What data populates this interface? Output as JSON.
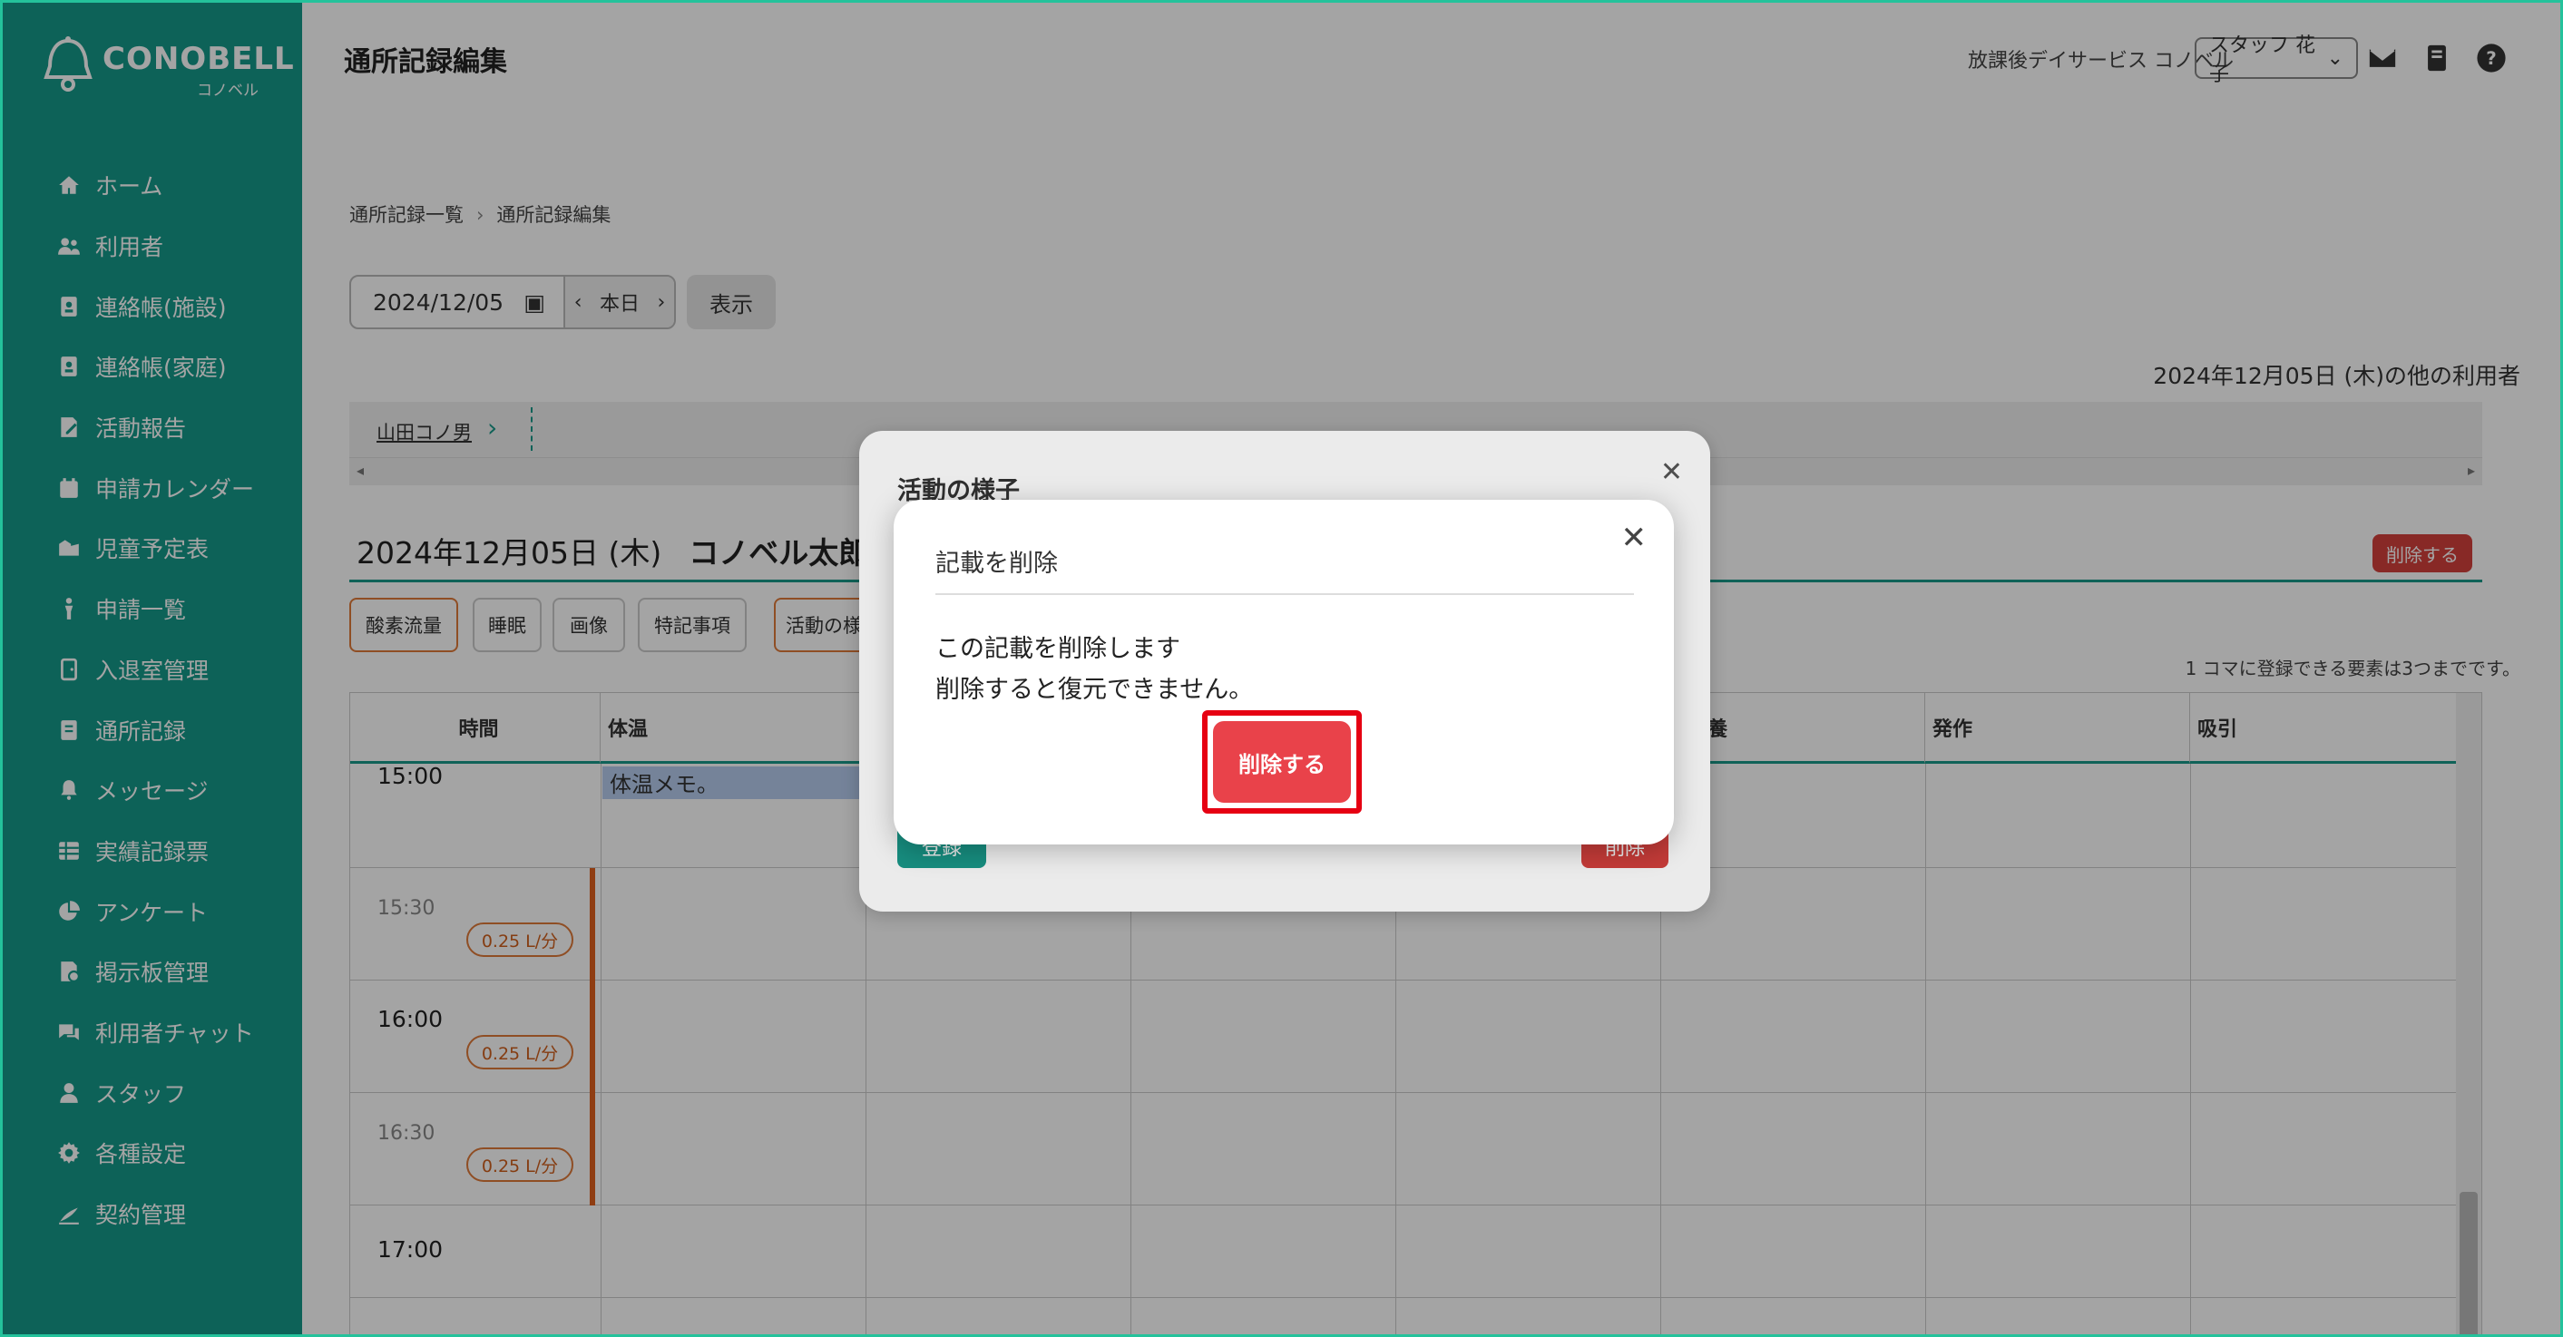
{
  "brand": {
    "name": "CONOBELL",
    "sub": "コノベル"
  },
  "sidebar": {
    "items": [
      {
        "label": "ホーム",
        "icon": "home-icon"
      },
      {
        "label": "利用者",
        "icon": "users-icon"
      },
      {
        "label": "連絡帳(施設)",
        "icon": "contact-book-icon"
      },
      {
        "label": "連絡帳(家庭)",
        "icon": "contact-book-icon"
      },
      {
        "label": "活動報告",
        "icon": "report-icon"
      },
      {
        "label": "申請カレンダー",
        "icon": "calendar-icon"
      },
      {
        "label": "児童予定表",
        "icon": "schedule-icon"
      },
      {
        "label": "申請一覧",
        "icon": "person-icon"
      },
      {
        "label": "入退室管理",
        "icon": "door-icon"
      },
      {
        "label": "通所記録",
        "icon": "record-icon"
      },
      {
        "label": "メッセージ",
        "icon": "bell-icon"
      },
      {
        "label": "実績記録票",
        "icon": "table-icon"
      },
      {
        "label": "アンケート",
        "icon": "pie-icon"
      },
      {
        "label": "掲示板管理",
        "icon": "board-icon"
      },
      {
        "label": "利用者チャット",
        "icon": "chat-icon"
      },
      {
        "label": "スタッフ",
        "icon": "staff-icon"
      },
      {
        "label": "各種設定",
        "icon": "gear-icon"
      },
      {
        "label": "契約管理",
        "icon": "contract-icon"
      }
    ]
  },
  "header": {
    "title": "通所記録編集",
    "office": "放課後デイサービス コノベル",
    "staff": "スタッフ 花子"
  },
  "breadcrumb": {
    "first": "通所記録一覧",
    "second": "通所記録編集"
  },
  "date_nav": {
    "date": "2024/12/05",
    "today": "本日",
    "show": "表示"
  },
  "other_users": "2024年12月05日 (木)の他の利用者",
  "user_tab": "山田コノ男",
  "record": {
    "date": "2024年12月05日 (木)",
    "name": "コノベル太郎",
    "delete": "削除する"
  },
  "tags": [
    "酸素流量",
    "睡眠",
    "画像",
    "特記事項",
    "活動の様"
  ],
  "limit_note": "1 コマに登録できる要素は3つまでです。",
  "grid": {
    "headers": [
      "時間",
      "体温",
      "",
      "",
      "",
      "・栄養",
      "発作",
      "吸引"
    ],
    "cell_note": "体温メモ。",
    "rows": [
      {
        "time": "15:00",
        "small": false,
        "pill": ""
      },
      {
        "time": "15:30",
        "small": true,
        "pill": "0.25 L/分"
      },
      {
        "time": "16:00",
        "small": false,
        "pill": "0.25 L/分"
      },
      {
        "time": "16:30",
        "small": true,
        "pill": "0.25 L/分"
      },
      {
        "time": "17:00",
        "small": false,
        "pill": ""
      }
    ]
  },
  "modal_activity": {
    "title": "活動の様子",
    "register": "登録",
    "delete": "削除"
  },
  "modal_confirm": {
    "title": "記載を削除",
    "line1": "この記載を削除します",
    "line2": "削除すると復元できません。",
    "button": "削除する"
  }
}
